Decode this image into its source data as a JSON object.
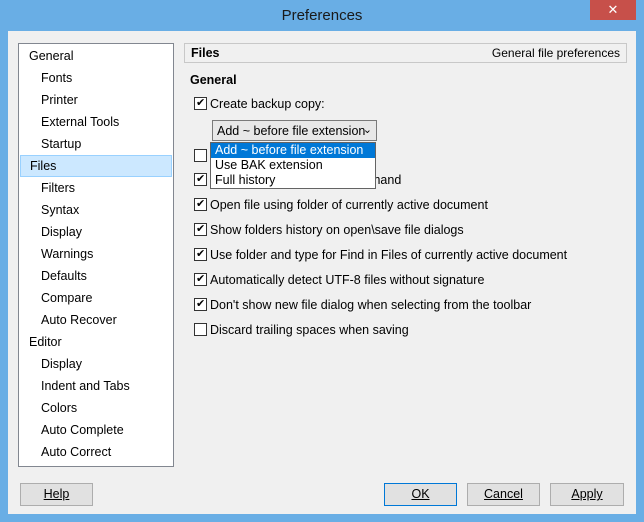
{
  "window": {
    "title": "Preferences",
    "close_glyph": "✕"
  },
  "sidebar": {
    "items": [
      {
        "label": "General",
        "level": 0
      },
      {
        "label": "Fonts",
        "level": 1
      },
      {
        "label": "Printer",
        "level": 1
      },
      {
        "label": "External Tools",
        "level": 1
      },
      {
        "label": "Startup",
        "level": 1
      },
      {
        "label": "Files",
        "level": 0,
        "selected": true
      },
      {
        "label": "Filters",
        "level": 1
      },
      {
        "label": "Syntax",
        "level": 1
      },
      {
        "label": "Display",
        "level": 1
      },
      {
        "label": "Warnings",
        "level": 1
      },
      {
        "label": "Defaults",
        "level": 1
      },
      {
        "label": "Compare",
        "level": 1
      },
      {
        "label": "Auto Recover",
        "level": 1
      },
      {
        "label": "Editor",
        "level": 0
      },
      {
        "label": "Display",
        "level": 1
      },
      {
        "label": "Indent and Tabs",
        "level": 1
      },
      {
        "label": "Colors",
        "level": 1
      },
      {
        "label": "Auto Complete",
        "level": 1
      },
      {
        "label": "Auto Correct",
        "level": 1
      }
    ]
  },
  "panel": {
    "title": "Files",
    "description": "General file preferences",
    "section_title": "General",
    "backup": {
      "label": "Create backup copy:",
      "checked": true,
      "combo_value": "Add ~ before file extension",
      "combo_arrow": "⌄",
      "dropdown_options": [
        "Add ~ before file extension",
        "Use BAK extension",
        "Full history"
      ],
      "highlighted_option": 0
    },
    "options": [
      {
        "label": "mand",
        "checked": true,
        "partially_hidden": true
      },
      {
        "label": "Open file using folder of currently active document",
        "checked": true
      },
      {
        "label": "Show folders history on open\\save file dialogs",
        "checked": true
      },
      {
        "label": "Use folder and type for Find in Files of currently active document",
        "checked": true
      },
      {
        "label": "Automatically detect UTF-8 files without signature",
        "checked": true
      },
      {
        "label": "Don't show new file dialog when selecting from the toolbar",
        "checked": true
      },
      {
        "label": "Discard trailing spaces when saving",
        "checked": false
      }
    ]
  },
  "buttons": {
    "help": "Help",
    "ok": "OK",
    "cancel": "Cancel",
    "apply": "Apply"
  }
}
